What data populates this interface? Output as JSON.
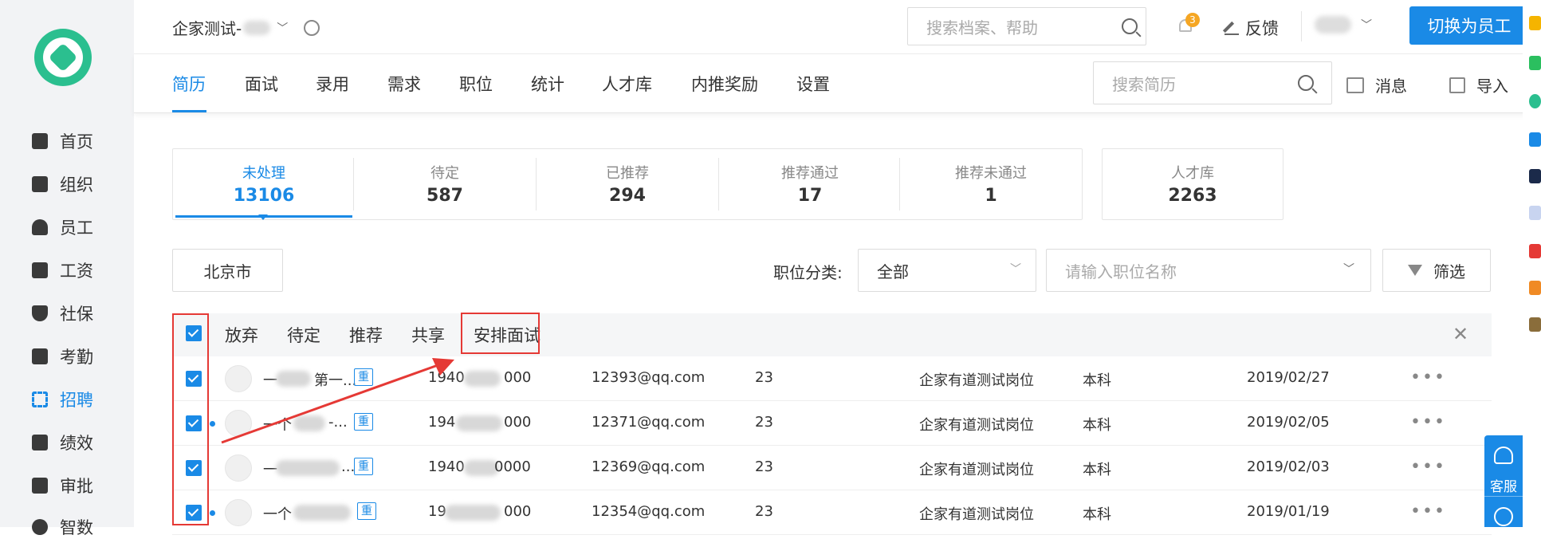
{
  "sidebar": {
    "items": [
      {
        "label": "首页",
        "icon": "home-icon"
      },
      {
        "label": "组织",
        "icon": "org-icon"
      },
      {
        "label": "员工",
        "icon": "user-icon"
      },
      {
        "label": "工资",
        "icon": "salary-icon"
      },
      {
        "label": "社保",
        "icon": "shield-icon"
      },
      {
        "label": "考勤",
        "icon": "calendar-icon"
      },
      {
        "label": "招聘",
        "icon": "recruit-icon",
        "active": true
      },
      {
        "label": "绩效",
        "icon": "chart-icon"
      },
      {
        "label": "审批",
        "icon": "stamp-icon"
      },
      {
        "label": "智数",
        "icon": "data-icon"
      }
    ]
  },
  "header": {
    "company": "企家测试-",
    "search_placeholder": "搜索档案、帮助",
    "bell_count": "3",
    "feedback": "反馈",
    "switch_button": "切换为员工"
  },
  "tabs": [
    "简历",
    "面试",
    "录用",
    "需求",
    "职位",
    "统计",
    "人才库",
    "内推奖励",
    "设置"
  ],
  "tabbar_right": {
    "search_placeholder": "搜索简历",
    "messages": "消息",
    "import": "导入"
  },
  "stats": [
    {
      "label": "未处理",
      "value": "13106"
    },
    {
      "label": "待定",
      "value": "587"
    },
    {
      "label": "已推荐",
      "value": "294"
    },
    {
      "label": "推荐通过",
      "value": "17"
    },
    {
      "label": "推荐未通过",
      "value": "1"
    }
  ],
  "talent_pool": {
    "label": "人才库",
    "value": "2263"
  },
  "filters": {
    "city": "北京市",
    "category_label": "职位分类:",
    "category_value": "全部",
    "position_placeholder": "请输入职位名称",
    "filter_button": "筛选"
  },
  "actions": [
    "放弃",
    "待定",
    "推荐",
    "共享",
    "安排面试"
  ],
  "tag_label": "重",
  "rows": [
    {
      "name": "一",
      "name_tail": "第一...",
      "phone_a": "1940",
      "phone_b": "000",
      "email": "12393@qq.com",
      "age": "23",
      "position": "企家有道测试岗位",
      "education": "本科",
      "date": "2019/02/27",
      "unread": false
    },
    {
      "name": "一个",
      "name_tail": "-...",
      "phone_a": "194",
      "phone_b": "000",
      "email": "12371@qq.com",
      "age": "23",
      "position": "企家有道测试岗位",
      "education": "本科",
      "date": "2019/02/05",
      "unread": true
    },
    {
      "name": "一",
      "name_tail": "...",
      "phone_a": "1940",
      "phone_b": "0000",
      "email": "12369@qq.com",
      "age": "23",
      "position": "企家有道测试岗位",
      "education": "本科",
      "date": "2019/02/03",
      "unread": false
    },
    {
      "name": "一个",
      "name_tail": "",
      "phone_a": "19",
      "phone_b": "000",
      "email": "12354@qq.com",
      "age": "23",
      "position": "企家有道测试岗位",
      "education": "本科",
      "date": "2019/01/19",
      "unread": true
    }
  ],
  "service": {
    "label": "客服"
  },
  "colors": {
    "accent": "#1a8ae6",
    "annotation": "#e53935",
    "logo": "#2bbf8f"
  }
}
